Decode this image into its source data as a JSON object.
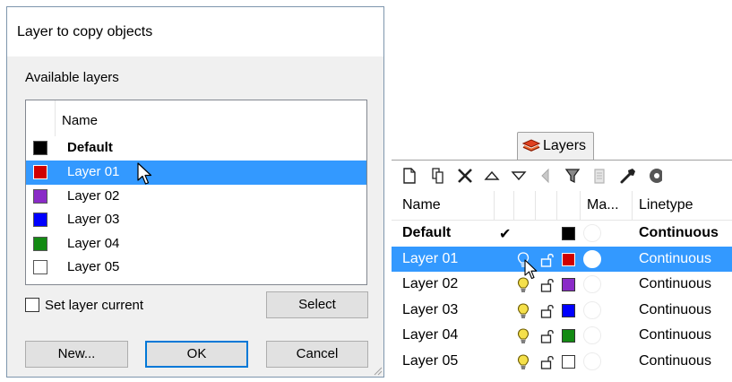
{
  "dialog": {
    "title": "Layer to copy objects",
    "group_label": "Available layers",
    "column_name": "Name",
    "layers": [
      {
        "name": "Default",
        "color": "#000000",
        "bold": true,
        "selected": false
      },
      {
        "name": "Layer 01",
        "color": "#d00000",
        "bold": false,
        "selected": true
      },
      {
        "name": "Layer 02",
        "color": "#8a2bc7",
        "bold": false,
        "selected": false
      },
      {
        "name": "Layer 03",
        "color": "#0000ff",
        "bold": false,
        "selected": false
      },
      {
        "name": "Layer 04",
        "color": "#138a13",
        "bold": false,
        "selected": false
      },
      {
        "name": "Layer 05",
        "color": "#ffffff",
        "bold": false,
        "selected": false
      }
    ],
    "checkbox_label": "Set layer current",
    "checkbox_checked": false,
    "select_label": "Select",
    "new_label": "New...",
    "ok_label": "OK",
    "cancel_label": "Cancel"
  },
  "panel": {
    "tab_label": "Layers",
    "toolbar_icons": [
      "new-layer-icon",
      "new-sublayer-icon",
      "delete-icon",
      "move-up-icon",
      "move-down-icon",
      "move-to-parent-icon",
      "filter-icon",
      "clipboard-icon",
      "tools-icon",
      "settings-icon"
    ],
    "columns": {
      "name": "Name",
      "material": "Ma...",
      "linetype": "Linetype"
    },
    "rows": [
      {
        "name": "Default",
        "current": true,
        "check": "✔",
        "color": "#000000",
        "linetype": "Continuous",
        "bold": true,
        "selected": false
      },
      {
        "name": "Layer 01",
        "current": false,
        "check": "",
        "color": "#d00000",
        "linetype": "Continuous",
        "bold": false,
        "selected": true
      },
      {
        "name": "Layer 02",
        "current": false,
        "check": "",
        "color": "#8a2bc7",
        "linetype": "Continuous",
        "bold": false,
        "selected": false
      },
      {
        "name": "Layer 03",
        "current": false,
        "check": "",
        "color": "#0000ff",
        "linetype": "Continuous",
        "bold": false,
        "selected": false
      },
      {
        "name": "Layer 04",
        "current": false,
        "check": "",
        "color": "#138a13",
        "linetype": "Continuous",
        "bold": false,
        "selected": false
      },
      {
        "name": "Layer 05",
        "current": false,
        "check": "",
        "color": "#ffffff",
        "linetype": "Continuous",
        "bold": false,
        "selected": false
      }
    ],
    "colors": {
      "selection": "#3399ff",
      "bulb": "#f0d000"
    }
  }
}
